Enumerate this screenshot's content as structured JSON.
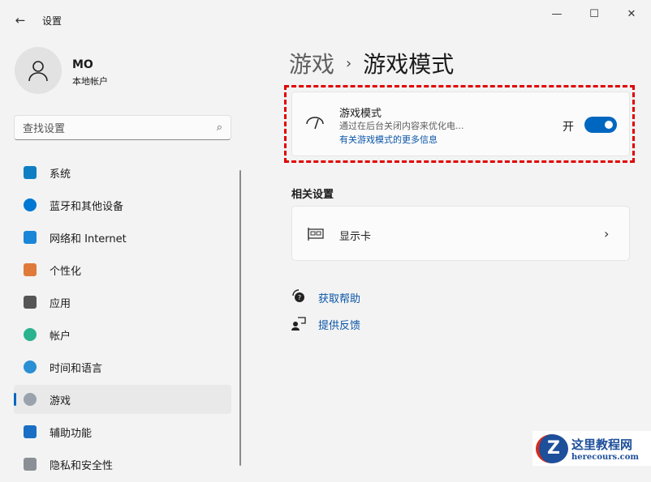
{
  "window": {
    "title": "设置",
    "minimize": "—",
    "maximize": "☐",
    "close": "✕",
    "back": "←"
  },
  "user": {
    "name": "MO",
    "type": "本地帐户"
  },
  "search": {
    "placeholder": "查找设置",
    "icon": "search-icon"
  },
  "nav": [
    {
      "label": "系统",
      "color": "#0f7fc4"
    },
    {
      "label": "蓝牙和其他设备",
      "color": "#0078d4"
    },
    {
      "label": "网络和 Internet",
      "color": "#1a86d8"
    },
    {
      "label": "个性化",
      "color": "#e07a3a"
    },
    {
      "label": "应用",
      "color": "#555555"
    },
    {
      "label": "帐户",
      "color": "#2ab38e"
    },
    {
      "label": "时间和语言",
      "color": "#2a8fd4"
    },
    {
      "label": "游戏",
      "color": "#9aa3ad",
      "active": true
    },
    {
      "label": "辅助功能",
      "color": "#1a6fc4"
    },
    {
      "label": "隐私和安全性",
      "color": "#8a8f96"
    }
  ],
  "breadcrumb": {
    "parent": "游戏",
    "sep": "›",
    "current": "游戏模式"
  },
  "game_mode": {
    "title": "游戏模式",
    "desc": "通过在后台关闭内容来优化电...",
    "link": "有关游戏模式的更多信息",
    "state": "开",
    "on": true
  },
  "related": {
    "title": "相关设置",
    "gpu": "显示卡",
    "chevron": "›"
  },
  "help": {
    "get_help": "获取帮助",
    "feedback": "提供反馈"
  },
  "watermark": {
    "name": "这里教程网",
    "url": "herecours.com",
    "letter": "Z"
  }
}
